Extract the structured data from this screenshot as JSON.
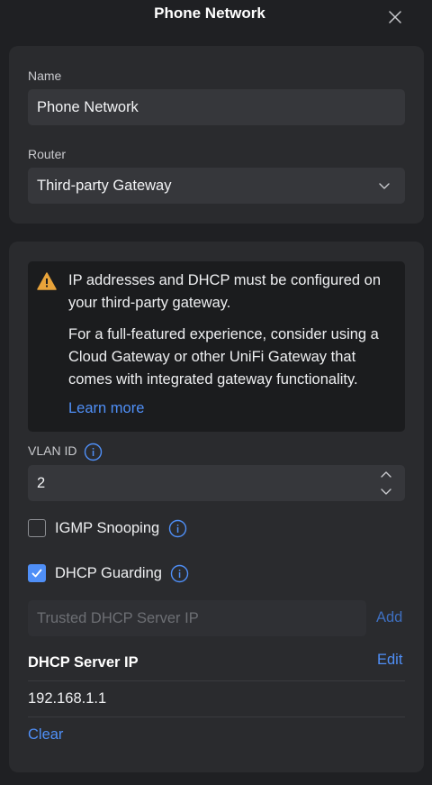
{
  "header": {
    "title": "Phone Network"
  },
  "general": {
    "name_label": "Name",
    "name_value": "Phone Network",
    "router_label": "Router",
    "router_value": "Third-party Gateway"
  },
  "alert": {
    "line1": "IP addresses and DHCP must be configured on your third-party gateway.",
    "line2": "For a full-featured experience, consider using a Cloud Gateway or other UniFi Gateway that comes with integrated gateway functionality.",
    "learn_more": "Learn more"
  },
  "vlan": {
    "label": "VLAN ID",
    "value": "2"
  },
  "igmp": {
    "label": "IGMP Snooping",
    "checked": false
  },
  "dhcp_guarding": {
    "label": "DHCP Guarding",
    "checked": true
  },
  "trusted_ip": {
    "placeholder": "Trusted DHCP Server IP",
    "add_label": "Add"
  },
  "dhcp_server": {
    "title": "DHCP Server IP",
    "edit_label": "Edit",
    "ip": "192.168.1.1",
    "clear_label": "Clear"
  },
  "colors": {
    "background": "#1f2023",
    "card": "#2a2b2e",
    "accent": "#4f8ff7",
    "warning": "#e8a33a"
  },
  "icons": [
    "close-icon",
    "chevron-down-icon",
    "warning-icon",
    "info-icon",
    "stepper-icon",
    "checkmark-icon"
  ]
}
